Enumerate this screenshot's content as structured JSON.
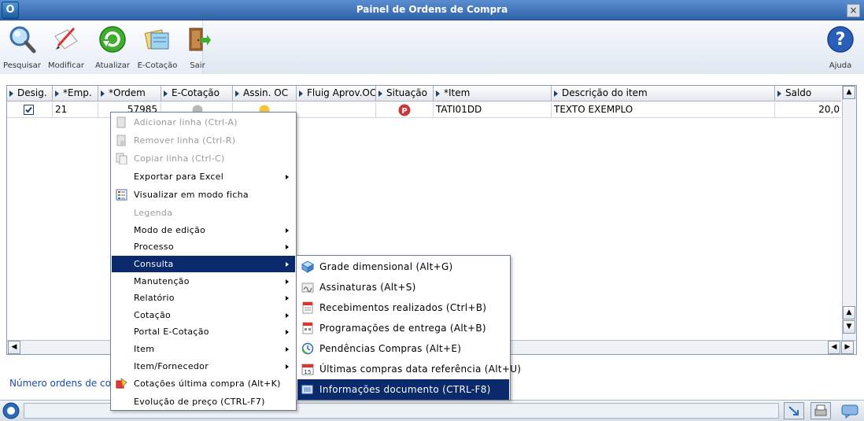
{
  "window": {
    "title": "Painel de Ordens de Compra",
    "close_glyph": "×"
  },
  "toolbar": {
    "buttons": [
      {
        "label": "Pesquisar",
        "icon": "magnifier-icon"
      },
      {
        "label": "Modificar",
        "icon": "edit-icon"
      },
      {
        "label": "Atualizar",
        "icon": "refresh-icon"
      },
      {
        "label": "E-Cotação",
        "icon": "quotation-icon"
      },
      {
        "label": "Sair",
        "icon": "exit-door-icon"
      }
    ],
    "help_label": "Ajuda"
  },
  "grid": {
    "columns": [
      "Desig.",
      "*Emp.",
      "*Ordem",
      "E-Cotação",
      "Assin. OC",
      "Fluig Aprov.OC",
      "Situação",
      "*Item",
      "Descrição do item",
      "Saldo"
    ],
    "rows": [
      {
        "desig": true,
        "emp": "21",
        "ordem": "57985",
        "ecotacao_icon": "info-gray-icon",
        "assin_icon": "yellow-status-icon",
        "fluig": "",
        "situacao_icon": "red-p-badge",
        "item": "TATI01DD",
        "descricao": "TEXTO EXEMPLO",
        "saldo": "20,0"
      }
    ]
  },
  "footer": {
    "link_text": "Número ordens de com"
  },
  "context_menu": {
    "items": [
      {
        "label": "Adicionar linha (Ctrl-A)",
        "disabled": true,
        "submenu": false,
        "icon": "add-row-icon"
      },
      {
        "label": "Remover linha (Ctrl-R)",
        "disabled": true,
        "submenu": false,
        "icon": "remove-row-icon"
      },
      {
        "label": "Copiar linha (Ctrl-C)",
        "disabled": true,
        "submenu": false,
        "icon": "copy-row-icon"
      },
      {
        "label": "Exportar para Excel",
        "disabled": false,
        "submenu": true,
        "icon": ""
      },
      {
        "label": "Visualizar em modo ficha",
        "disabled": false,
        "submenu": false,
        "icon": "form-view-icon"
      },
      {
        "label": "Legenda",
        "disabled": true,
        "submenu": false,
        "icon": ""
      },
      {
        "label": "Modo de edição",
        "disabled": false,
        "submenu": true,
        "icon": ""
      },
      {
        "label": "Processo",
        "disabled": false,
        "submenu": true,
        "icon": ""
      },
      {
        "label": "Consulta",
        "disabled": false,
        "submenu": true,
        "icon": "",
        "highlighted": true
      },
      {
        "label": "Manutenção",
        "disabled": false,
        "submenu": true,
        "icon": ""
      },
      {
        "label": "Relatório",
        "disabled": false,
        "submenu": true,
        "icon": ""
      },
      {
        "label": "Cotação",
        "disabled": false,
        "submenu": true,
        "icon": ""
      },
      {
        "label": "Portal E-Cotação",
        "disabled": false,
        "submenu": true,
        "icon": ""
      },
      {
        "label": "Item",
        "disabled": false,
        "submenu": true,
        "icon": ""
      },
      {
        "label": "Item/Fornecedor",
        "disabled": false,
        "submenu": true,
        "icon": ""
      },
      {
        "label": "Cotações última compra (Alt+K)",
        "disabled": false,
        "submenu": false,
        "icon": "quotation-last-icon"
      },
      {
        "label": "Evolução de preço (CTRL-F7)",
        "disabled": false,
        "submenu": false,
        "icon": ""
      }
    ]
  },
  "submenu": {
    "items": [
      {
        "label": "Grade dimensional (Alt+G)",
        "icon": "cube-icon"
      },
      {
        "label": "Assinaturas (Alt+S)",
        "icon": "signature-icon"
      },
      {
        "label": "Recebimentos realizados (Ctrl+B)",
        "icon": "receipt-icon"
      },
      {
        "label": "Programações de entrega (Alt+B)",
        "icon": "delivery-schedule-icon"
      },
      {
        "label": "Pendências Compras (Alt+E)",
        "icon": "pending-clock-icon"
      },
      {
        "label": "Últimas compras data referência (Alt+U)",
        "icon": "calendar-icon"
      },
      {
        "label": "Informações documento (CTRL-F8)",
        "icon": "document-info-icon",
        "highlighted": true
      }
    ]
  },
  "colors": {
    "menu_highlight": "#0a2a6b",
    "title_bar": "#2f63a9",
    "link": "#1a4ea6"
  }
}
